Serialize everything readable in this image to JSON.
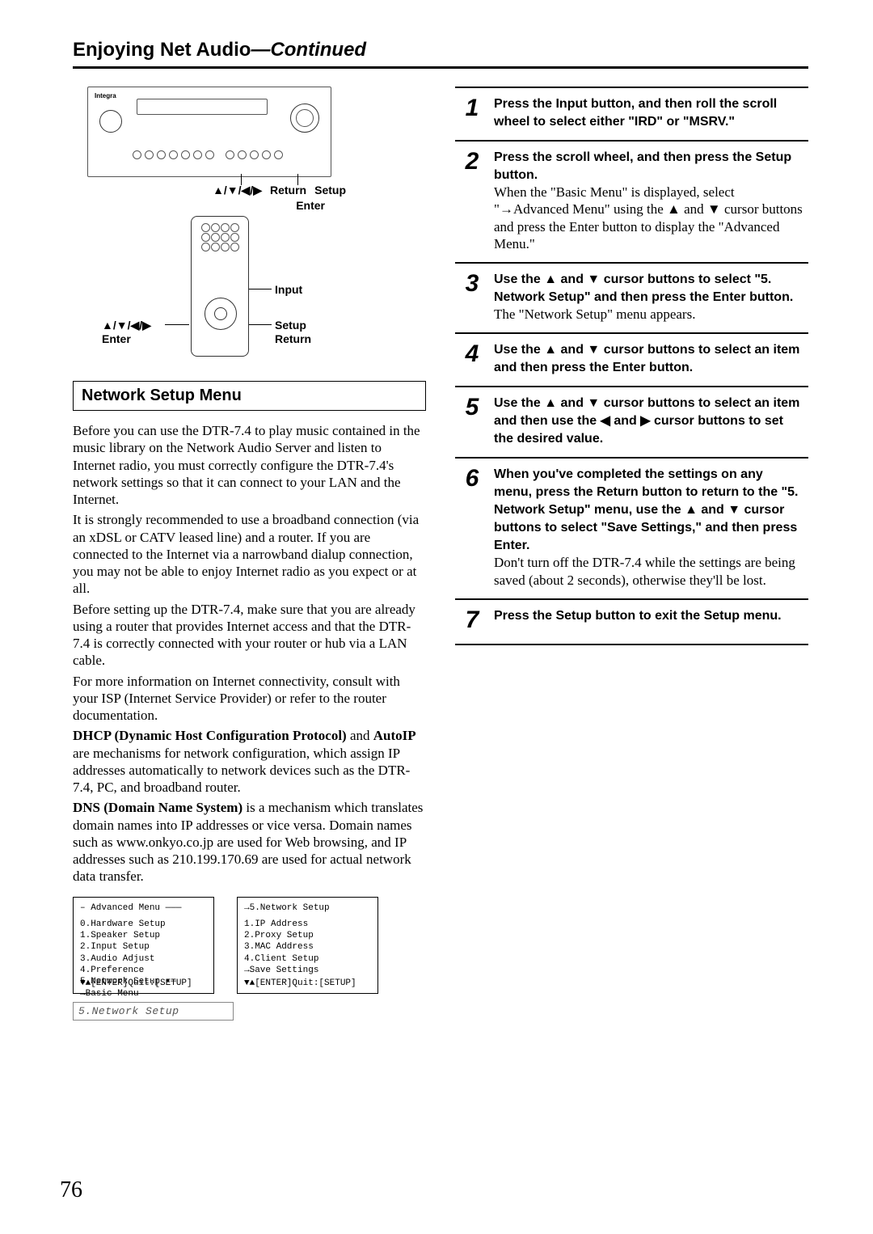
{
  "header": {
    "title": "Enjoying Net Audio",
    "continued": "—Continued"
  },
  "diagram": {
    "brand": "Integra",
    "top_labels": {
      "arrows": "▲/▼/◀/▶",
      "return": "Return",
      "setup": "Setup",
      "enter": "Enter"
    },
    "side_labels": {
      "input": "Input",
      "setup": "Setup",
      "return": "Return",
      "arrows": "▲/▼/◀/▶",
      "enter": "Enter"
    }
  },
  "section_heading": "Network Setup Menu",
  "body": {
    "p1": "Before you can use the DTR-7.4 to play music contained in the music library on the Network Audio Server and listen to Internet radio, you must correctly configure the DTR-7.4's network settings so that it can connect to your LAN and the Internet.",
    "p2": "It is strongly recommended to use a broadband connection (via an xDSL or CATV leased line) and a router. If you are connected to the Internet via a narrowband dialup connection, you may not be able to enjoy Internet radio as you expect or at all.",
    "p3": "Before setting up the DTR-7.4, make sure that you are already using a router that provides Internet access and that the DTR-7.4 is correctly connected with your router or hub via a LAN cable.",
    "p4": "For more information on Internet connectivity, consult with your ISP (Internet Service Provider) or refer to the router documentation.",
    "p5a": "DHCP (Dynamic Host Configuration Protocol)",
    "p5b": " and ",
    "p5c": "AutoIP",
    "p5d": " are mechanisms for network configuration, which assign IP addresses automatically to network devices such as the DTR-7.4, PC, and broadband router.",
    "p6a": "DNS (Domain Name System)",
    "p6b": " is a mechanism which translates domain names into IP addresses or vice versa. Domain names such as www.onkyo.co.jp are used for Web browsing, and IP addresses such as 210.199.170.69 are used for actual network data transfer."
  },
  "screens": {
    "left": {
      "title": "– Advanced Menu ———",
      "items": [
        "0.Hardware Setup",
        "1.Speaker Setup",
        "2.Input Setup",
        "3.Audio Adjust",
        "4.Preference",
        "5.Network Setup   •—",
        "          →Basic Menu"
      ],
      "footer": "▼▲[ENTER]Quit:[SETUP]"
    },
    "right": {
      "title": "→5.Network Setup",
      "items": [
        "1.IP Address",
        "2.Proxy Setup",
        "3.MAC Address",
        "4.Client Setup",
        "",
        "       →Save Settings"
      ],
      "footer": "▼▲[ENTER]Quit:[SETUP]"
    }
  },
  "lcd": "5.Network Setup",
  "steps": [
    {
      "num": "1",
      "bold": "Press the Input button, and then roll the scroll wheel to select either \"IRD\" or \"MSRV.\"",
      "plain": ""
    },
    {
      "num": "2",
      "bold": "Press the scroll wheel, and then press the Setup button.",
      "plain": "When the \"Basic Menu\" is displayed, select \"→Advanced Menu\" using the ▲ and ▼ cursor buttons and press the Enter button to display the \"Advanced Menu.\""
    },
    {
      "num": "3",
      "bold": "Use the ▲ and ▼ cursor buttons to select \"5. Network Setup\" and then press the Enter button.",
      "plain": "The \"Network Setup\" menu appears."
    },
    {
      "num": "4",
      "bold": "Use the ▲ and ▼ cursor buttons to select an item and then press the Enter button.",
      "plain": ""
    },
    {
      "num": "5",
      "bold": "Use the ▲ and ▼ cursor buttons to select an item and then use the ◀ and ▶ cursor buttons to set the desired value.",
      "plain": ""
    },
    {
      "num": "6",
      "bold": "When you've completed the settings on any menu, press the Return button to return to the \"5. Network Setup\" menu, use the ▲ and ▼ cursor buttons to select \"Save Settings,\" and then press Enter.",
      "plain": "Don't turn off the DTR-7.4 while the settings are being saved (about 2 seconds), otherwise they'll be lost."
    },
    {
      "num": "7",
      "bold": "Press the Setup button to exit the Setup menu.",
      "plain": ""
    }
  ],
  "page_number": "76"
}
